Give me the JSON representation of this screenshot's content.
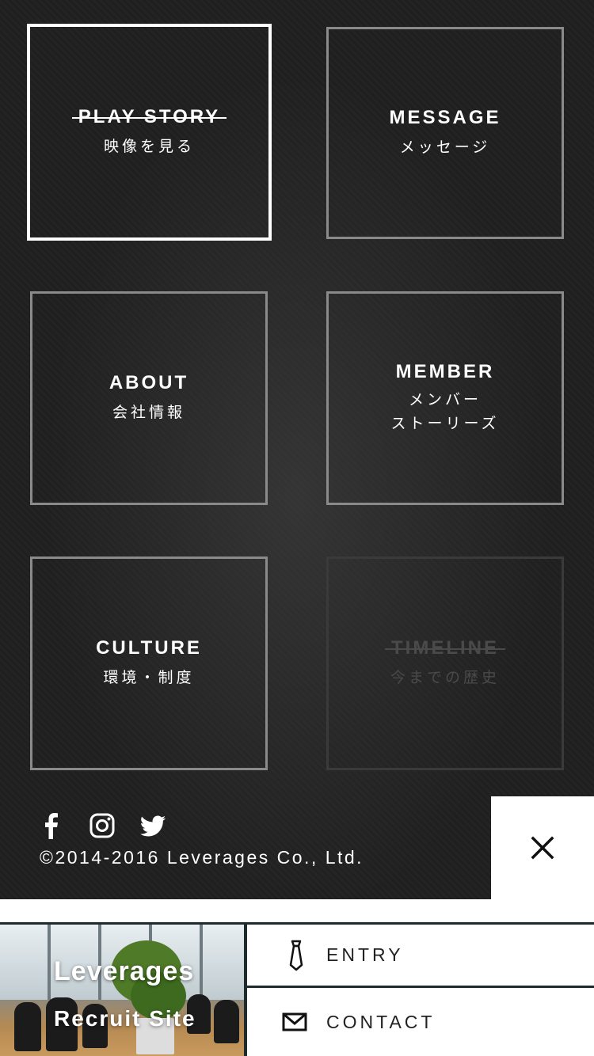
{
  "menu": {
    "tiles": [
      {
        "en": "PLAY STORY",
        "ja": "映像を見る"
      },
      {
        "en": "MESSAGE",
        "ja": "メッセージ"
      },
      {
        "en": "ABOUT",
        "ja": "会社情報"
      },
      {
        "en": "MEMBER",
        "ja": "メンバー",
        "ja2": "ストーリーズ"
      },
      {
        "en": "CULTURE",
        "ja": "環境・制度"
      },
      {
        "en": "TIMELINE",
        "ja": "今までの歴史"
      }
    ],
    "copyright": "©2014-2016 Leverages Co., Ltd.",
    "social_icons": [
      "facebook-icon",
      "instagram-icon",
      "twitter-icon"
    ],
    "close_icon": "close-icon"
  },
  "bottom": {
    "hero": {
      "brand": "Leverages",
      "sub": "Recruit Site"
    },
    "entry": {
      "label": "ENTRY",
      "icon": "necktie-icon"
    },
    "contact": {
      "label": "CONTACT",
      "icon": "envelope-icon"
    }
  },
  "colors": {
    "panel": "#1c1c1c",
    "tile_border": "#8a8a8a",
    "active_border": "#ffffff",
    "disabled": "#3a3a3a",
    "rule": "#1f2a2c"
  }
}
